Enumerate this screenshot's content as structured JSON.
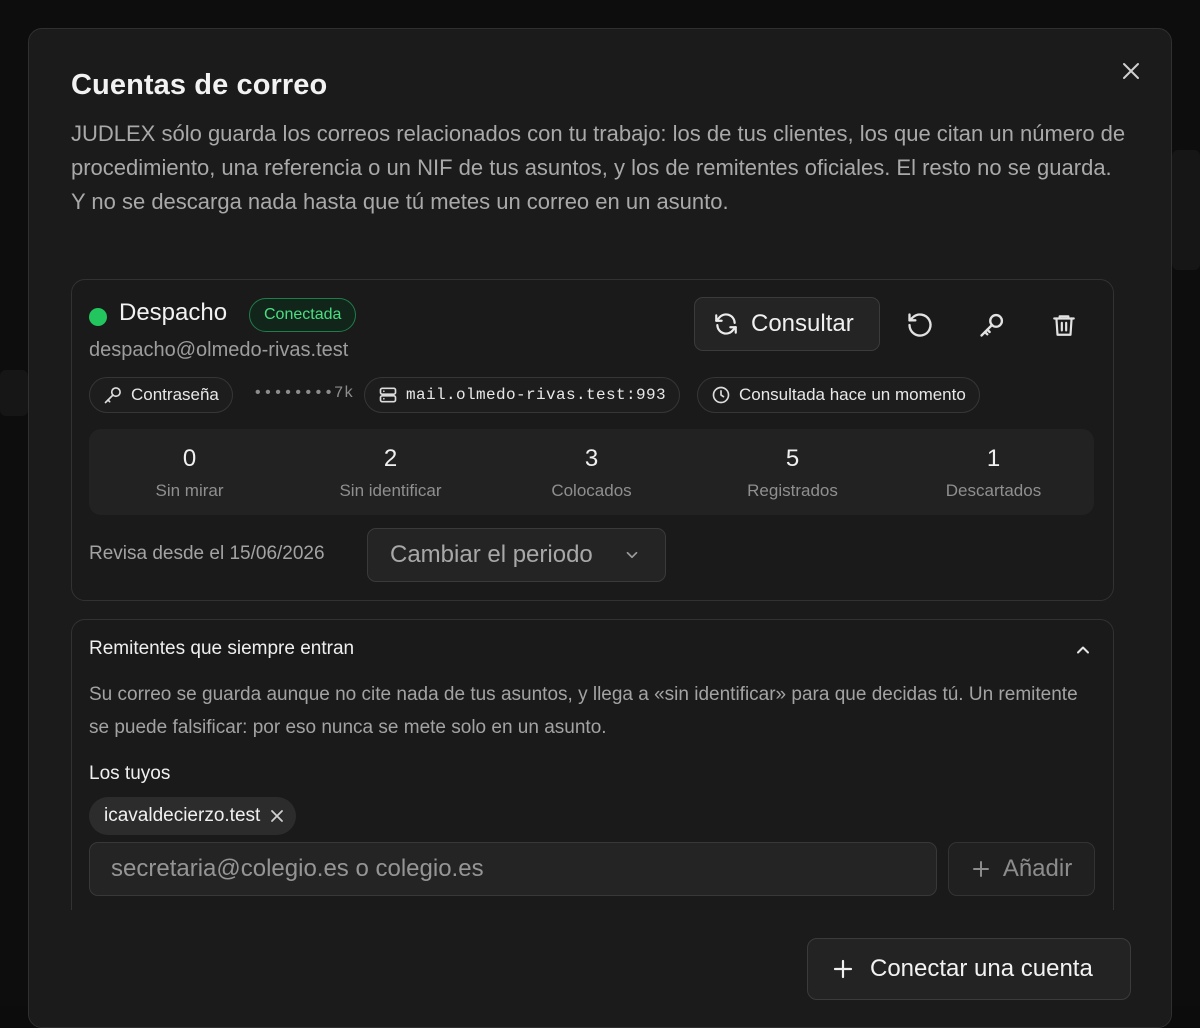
{
  "modal": {
    "title": "Cuentas de correo",
    "description": "JUDLEX sólo guarda los correos relacionados con tu trabajo: los de tus clientes, los que citan un número de procedimiento, una referencia o un NIF de tus asuntos, y los de remitentes oficiales. El resto no se guarda. Y no se descarga nada hasta que tú metes un correo en un asunto.",
    "close_icon": "close-icon"
  },
  "account": {
    "name": "Despacho",
    "status": "Conectada",
    "email": "despacho@olmedo-rivas.test",
    "consult_label": "Consultar",
    "auth_label": "Contraseña",
    "password_mask": "••••••••7k",
    "server": "mail.olmedo-rivas.test:993",
    "last_check": "Consultada hace un momento",
    "stats": [
      {
        "value": "0",
        "label": "Sin mirar"
      },
      {
        "value": "2",
        "label": "Sin identificar"
      },
      {
        "value": "3",
        "label": "Colocados"
      },
      {
        "value": "5",
        "label": "Registrados"
      },
      {
        "value": "1",
        "label": "Descartados"
      }
    ],
    "period_label": "Revisa desde el 15/06/2026",
    "period_select": "Cambiar el periodo"
  },
  "senders": {
    "title": "Remitentes que siempre entran",
    "description": "Su correo se guarda aunque no cite nada de tus asuntos, y llega a «sin identificar» para que decidas tú. Un remitente se puede falsificar: por eso nunca se mete solo en un asunto.",
    "yours_label": "Los tuyos",
    "items": [
      {
        "label": "icavaldecierzo.test"
      }
    ],
    "input_placeholder": "secretaria@colegio.es o colegio.es",
    "add_label": "Añadir"
  },
  "footer": {
    "connect_label": "Conectar una cuenta"
  },
  "colors": {
    "accent_green": "#4ade80",
    "status_dot": "#22c55e",
    "modal_bg": "#1b1b1b"
  }
}
